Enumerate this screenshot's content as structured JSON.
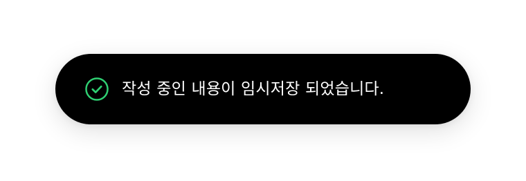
{
  "toast": {
    "icon": "check-circle-icon",
    "icon_color": "#2fcf72",
    "background": "#000000",
    "message": "작성 중인 내용이 임시저장 되었습니다."
  }
}
